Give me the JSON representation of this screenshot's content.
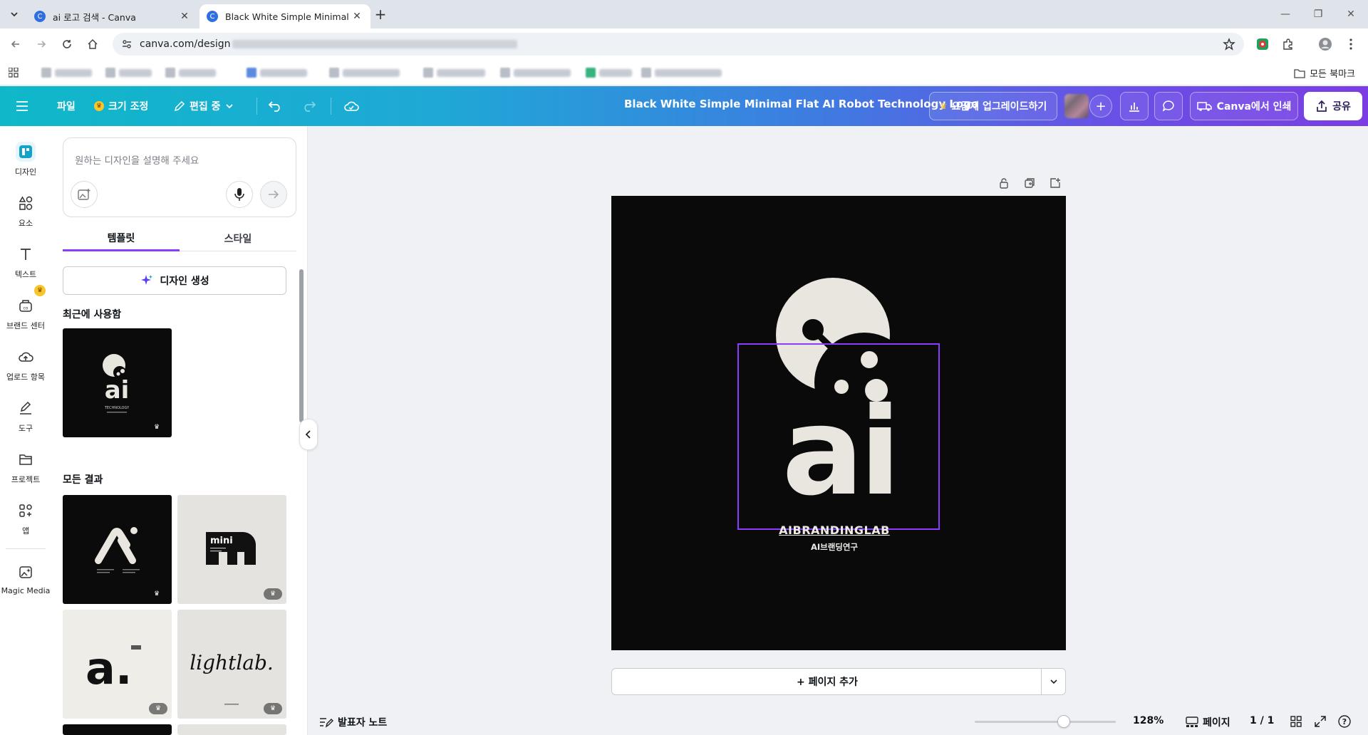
{
  "browser": {
    "tabs": [
      {
        "title": "ai 로고 검색 - Canva",
        "active": false
      },
      {
        "title": "Black White Simple Minimal Fl",
        "active": true
      }
    ],
    "url": "canva.com/design",
    "all_bookmarks": "모든 북마크"
  },
  "topbar": {
    "file": "파일",
    "resize": "크기 조정",
    "editing": "편집 중",
    "doc_title": "Black White Simple Minimal Flat  AI Robot Technology Logo",
    "upgrade": "요금제 업그레이드하기",
    "print": "Canva에서 인쇄",
    "share": "공유"
  },
  "rail": [
    {
      "label": "디자인",
      "icon": "design-icon",
      "active": true
    },
    {
      "label": "요소",
      "icon": "elements-icon"
    },
    {
      "label": "텍스트",
      "icon": "text-icon"
    },
    {
      "label": "브랜드 센터",
      "icon": "brand-icon"
    },
    {
      "label": "업로드 항목",
      "icon": "upload-icon"
    },
    {
      "label": "도구",
      "icon": "draw-icon"
    },
    {
      "label": "프로젝트",
      "icon": "folder-icon"
    },
    {
      "label": "앱",
      "icon": "apps-icon"
    },
    {
      "label": "Magic Media",
      "icon": "magic-media-icon"
    }
  ],
  "panel": {
    "prompt_placeholder": "원하는 디자인을 설명해 주세요",
    "tab_templates": "템플릿",
    "tab_styles": "스타일",
    "generate_button": "디자인 생성",
    "recent_heading": "최근에 사용함",
    "results_heading": "모든 결과",
    "recent_thumb": {
      "logo": "ai",
      "caption": "TECHNOLOGY"
    },
    "results": [
      {
        "text": "",
        "style": "dark"
      },
      {
        "text": "mini",
        "style": "light"
      },
      {
        "text": "a.",
        "style": "light"
      },
      {
        "text": "lightlab.",
        "style": "light"
      }
    ]
  },
  "canvas": {
    "logo_text": "ai",
    "brand_main": "AIBRANDINGLAB",
    "brand_sub": "AI브랜딩연구",
    "add_page": "+ 페이지 추가"
  },
  "bottom": {
    "notes": "발표자 노트",
    "zoom": "128%",
    "zoom_fraction": 0.63,
    "pages_label": "페이지",
    "page_count": "1 / 1"
  },
  "colors": {
    "accent": "#8b3dff",
    "topbar_start": "#0fb8c9",
    "topbar_end": "#7a3de3",
    "artboard_bg": "#0a0a0a",
    "logo_fg": "#ecebe6"
  }
}
